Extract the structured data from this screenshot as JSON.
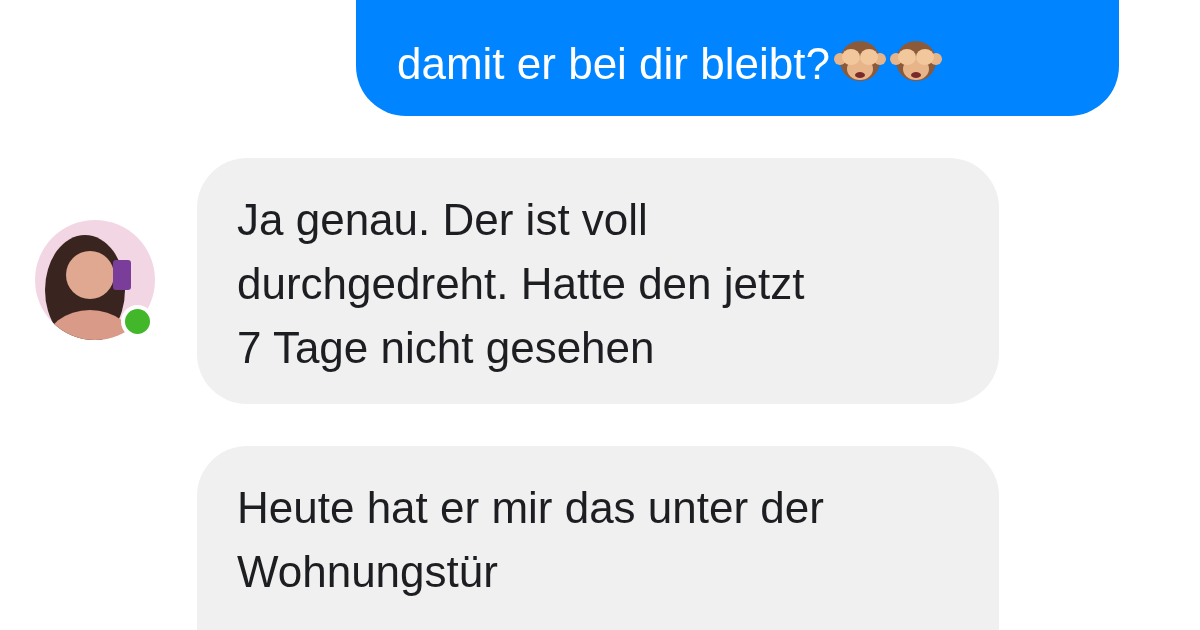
{
  "messages": [
    {
      "kind": "sent",
      "text": "damit er bei dir bleibt?",
      "icons": [
        {
          "kind": "monkey"
        },
        {
          "kind": "monkey"
        }
      ]
    },
    {
      "kind": "received",
      "text": "Ja genau. Der ist voll\ndurchgedreht. Hatte den jetzt\n7 Tage nicht gesehen",
      "avatar": true,
      "online": true
    },
    {
      "kind": "received",
      "text": "Heute hat er mir das unter der\nWohnungstür",
      "avatar": false
    }
  ]
}
